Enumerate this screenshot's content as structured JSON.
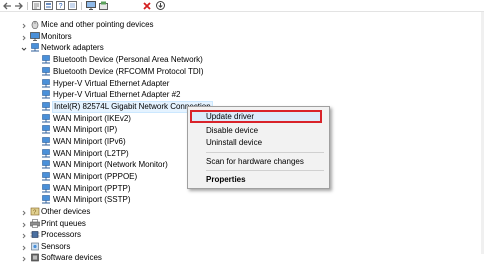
{
  "colors": {
    "highlight_border": "#d9232a",
    "menu_bg": "#f2f2f2",
    "menu_highlight": "#dcebfa",
    "network_icon": "#2c7ad6",
    "selection_bg": "#e5f3ff"
  },
  "toolbar": {
    "buttons": [
      {
        "icon": "back-arrow-icon"
      },
      {
        "icon": "forward-arrow-icon"
      },
      {
        "icon": "properties-icon"
      },
      {
        "icon": "device-list-icon"
      },
      {
        "icon": "help-icon"
      },
      {
        "icon": "view-icon"
      },
      {
        "icon": "monitor-icon"
      },
      {
        "icon": "update-driver-icon"
      },
      {
        "icon": "uninstall-x-icon"
      },
      {
        "icon": "scan-download-icon"
      }
    ]
  },
  "tree": {
    "rows": [
      {
        "label": "Mice and other pointing devices",
        "icon": "mouse-icon",
        "expanded": false
      },
      {
        "label": "Monitors",
        "icon": "monitor-icon",
        "expanded": false
      },
      {
        "label": "Network adapters",
        "icon": "network-adapter-icon",
        "expanded": true
      },
      {
        "label": "Bluetooth Device (Personal Area Network)",
        "icon": "network-adapter-icon"
      },
      {
        "label": "Bluetooth Device (RFCOMM Protocol TDI)",
        "icon": "network-adapter-icon"
      },
      {
        "label": "Hyper-V Virtual Ethernet Adapter",
        "icon": "network-adapter-icon"
      },
      {
        "label": "Hyper-V Virtual Ethernet Adapter #2",
        "icon": "network-adapter-icon"
      },
      {
        "label": "Intel(R) 82574L Gigabit Network Connection",
        "icon": "network-adapter-icon",
        "selected": true
      },
      {
        "label": "WAN Miniport (IKEv2)",
        "icon": "network-adapter-icon"
      },
      {
        "label": "WAN Miniport (IP)",
        "icon": "network-adapter-icon"
      },
      {
        "label": "WAN Miniport (IPv6)",
        "icon": "network-adapter-icon"
      },
      {
        "label": "WAN Miniport (L2TP)",
        "icon": "network-adapter-icon"
      },
      {
        "label": "WAN Miniport (Network Monitor)",
        "icon": "network-adapter-icon"
      },
      {
        "label": "WAN Miniport (PPPOE)",
        "icon": "network-adapter-icon"
      },
      {
        "label": "WAN Miniport (PPTP)",
        "icon": "network-adapter-icon"
      },
      {
        "label": "WAN Miniport (SSTP)",
        "icon": "network-adapter-icon"
      },
      {
        "label": "Other devices",
        "icon": "other-devices-icon",
        "expanded": false
      },
      {
        "label": "Print queues",
        "icon": "printer-icon",
        "expanded": false
      },
      {
        "label": "Processors",
        "icon": "processor-icon",
        "expanded": false
      },
      {
        "label": "Sensors",
        "icon": "sensor-icon",
        "expanded": false
      },
      {
        "label": "Software devices",
        "icon": "software-device-icon",
        "expanded": false
      }
    ]
  },
  "context_menu": {
    "items": [
      {
        "label": "Update driver",
        "highlighted": true
      },
      {
        "label": "Disable device"
      },
      {
        "label": "Uninstall device"
      },
      {
        "label": "Scan for hardware changes"
      },
      {
        "label": "Properties",
        "bold": true
      }
    ]
  }
}
